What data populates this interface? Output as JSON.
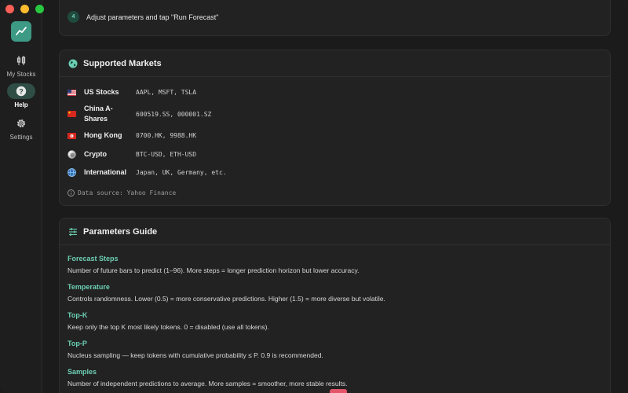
{
  "sidebar": {
    "items": [
      {
        "label": "My Stocks",
        "icon": "candlestick-icon"
      },
      {
        "label": "Help",
        "icon": "help-icon",
        "active": true
      },
      {
        "label": "Settings",
        "icon": "gear-icon"
      }
    ]
  },
  "steps": {
    "items": [
      {
        "number": "4",
        "text": "Adjust parameters and tap \"Run Forecast\""
      }
    ]
  },
  "markets": {
    "title": "Supported Markets",
    "icon": "globe-icon",
    "rows": [
      {
        "name": "US Stocks",
        "codes": "AAPL, MSFT, TSLA",
        "flag": "us-flag"
      },
      {
        "name": "China A-Shares",
        "codes": "600519.SS, 000001.SZ",
        "flag": "cn-flag"
      },
      {
        "name": "Hong Kong",
        "codes": "0700.HK, 9988.HK",
        "flag": "hk-flag"
      },
      {
        "name": "Crypto",
        "codes": "BTC-USD, ETH-USD",
        "flag": "coin-icon"
      },
      {
        "name": "International",
        "codes": "Japan, UK, Germany, etc.",
        "flag": "globe-icon"
      }
    ],
    "source": "Data source: Yahoo Finance"
  },
  "params": {
    "title": "Parameters Guide",
    "icon": "sliders-icon",
    "items": [
      {
        "name": "Forecast Steps",
        "desc": "Number of future bars to predict (1–96). More steps = longer prediction horizon but lower accuracy."
      },
      {
        "name": "Temperature",
        "desc": "Controls randomness. Lower (0.5) = more conservative predictions. Higher (1.5) = more diverse but volatile."
      },
      {
        "name": "Top-K",
        "desc": "Keep only the top K most likely tokens. 0 = disabled (use all tokens)."
      },
      {
        "name": "Top-P",
        "desc": "Nucleus sampling — keep tokens with cumulative probability ≤ P. 0.9 is recommended."
      },
      {
        "name": "Samples",
        "desc": "Number of independent predictions to average. More samples = smoother, more stable results."
      }
    ]
  },
  "colors": {
    "accent": "#6ccfb3",
    "logo_bg": "#3d9a85",
    "background": "#1b1b1b",
    "card": "#222222"
  }
}
